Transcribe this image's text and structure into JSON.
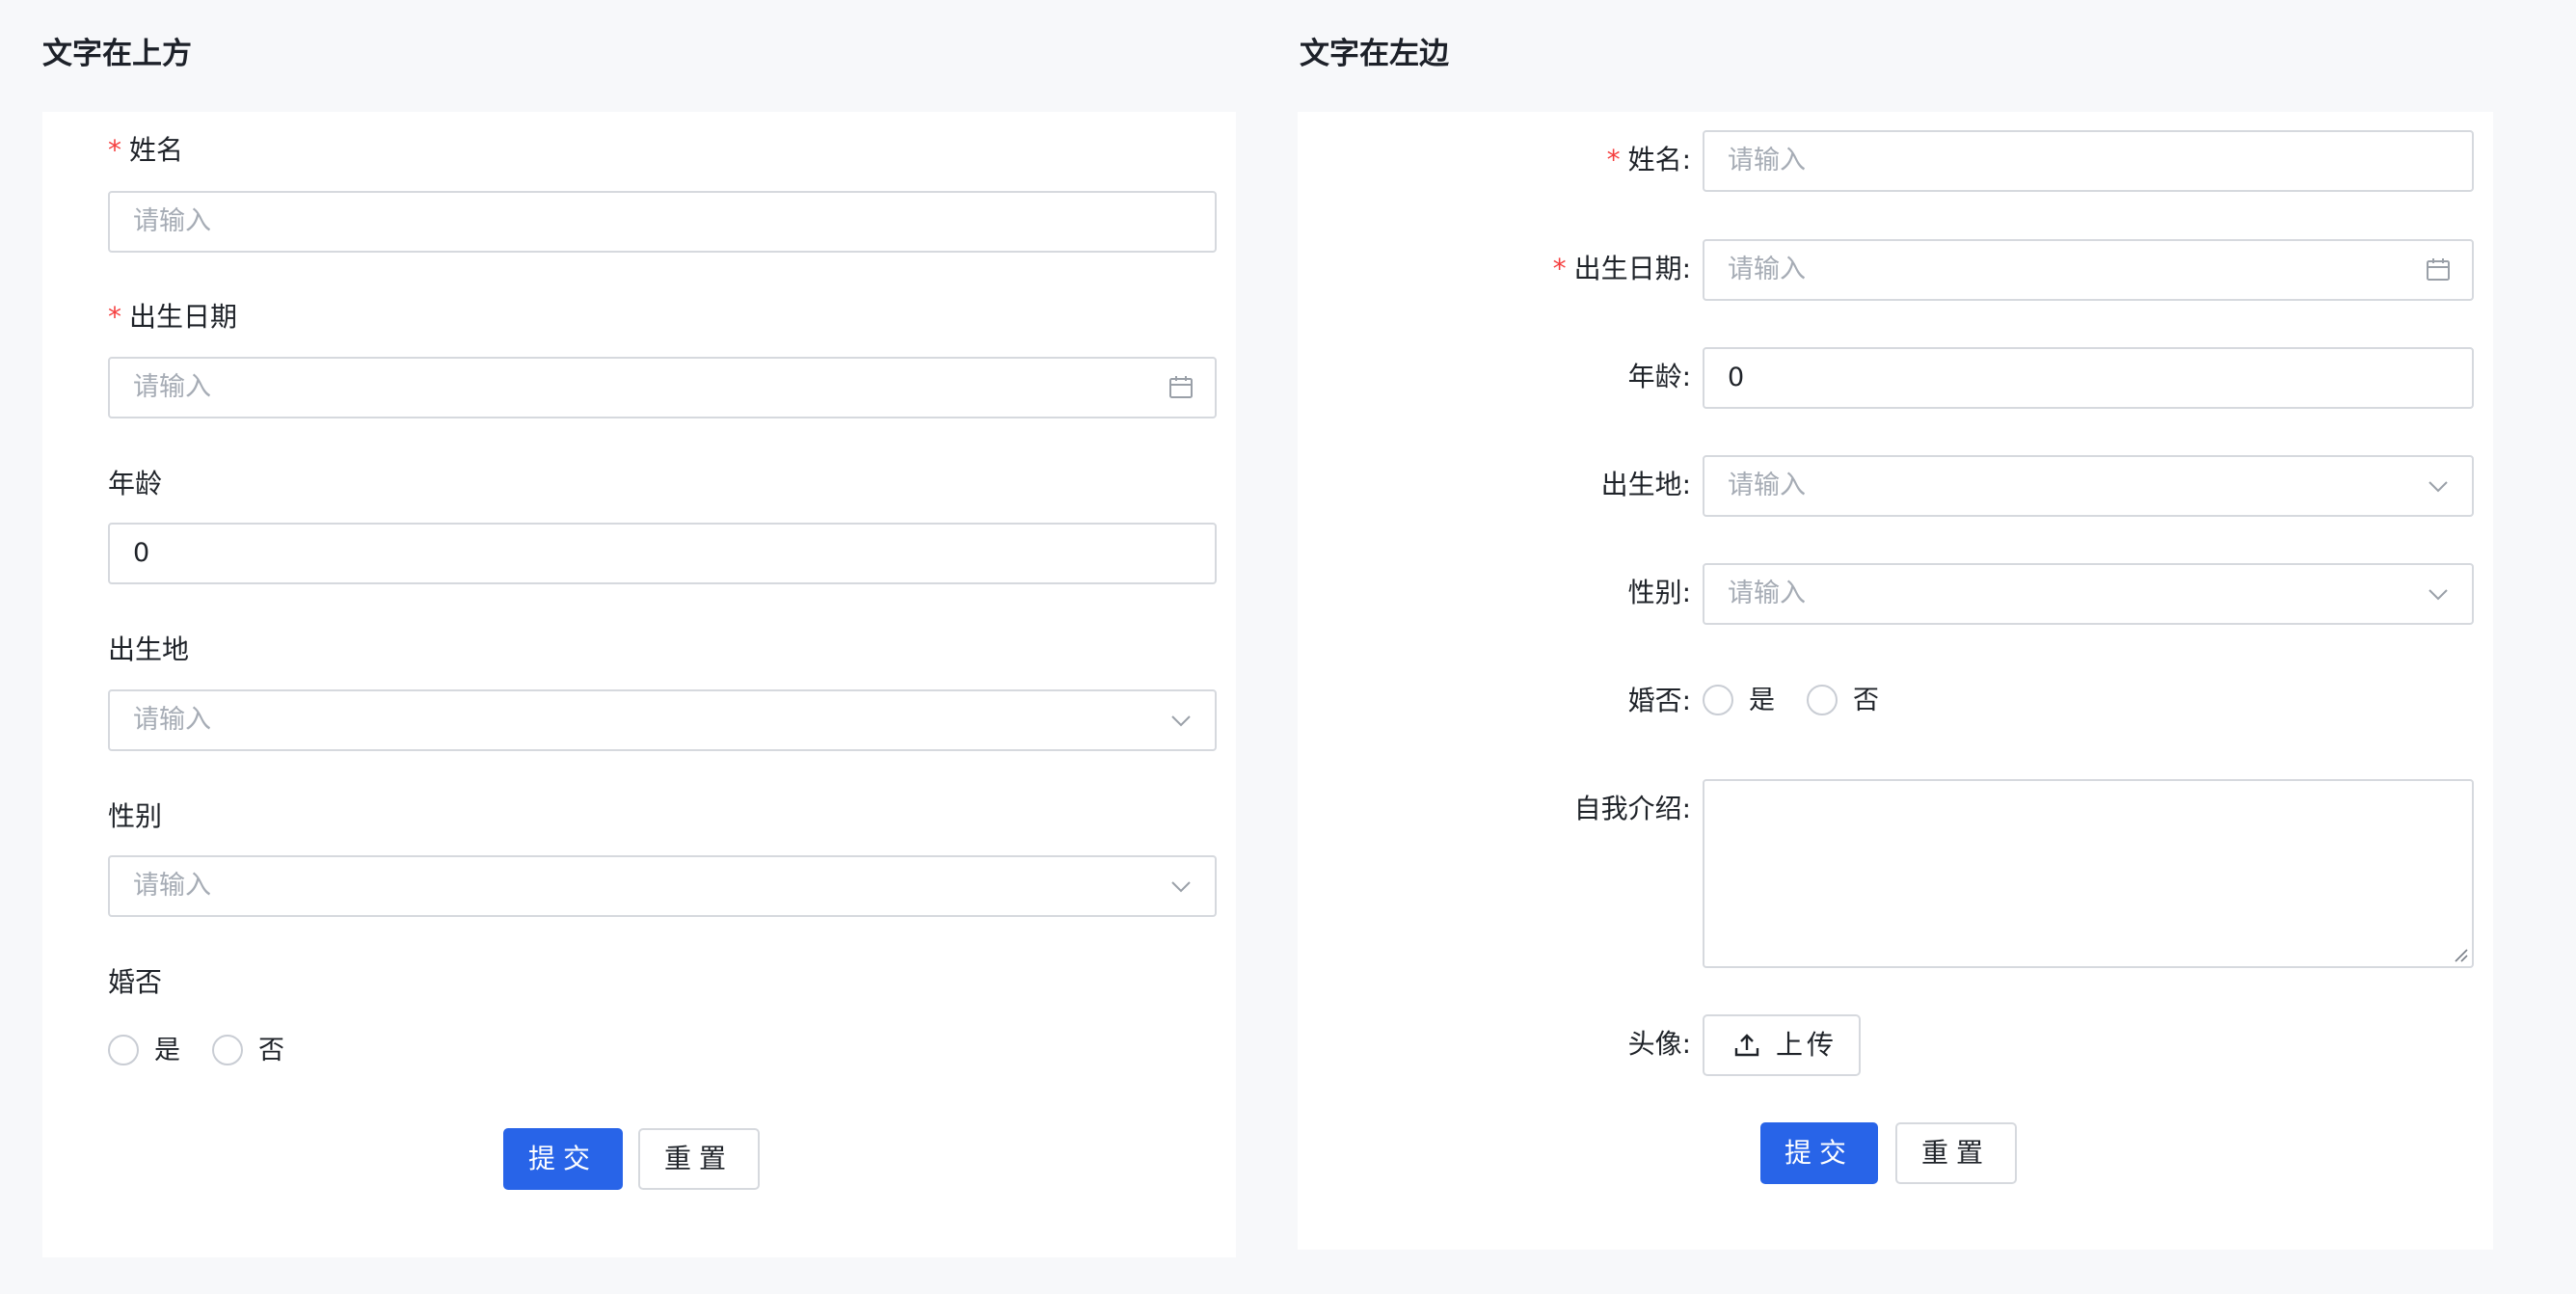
{
  "top_form": {
    "title": "文字在上方",
    "fields": {
      "name": {
        "label": "姓名",
        "placeholder": "请输入",
        "required": "*"
      },
      "birthdate": {
        "label": "出生日期",
        "placeholder": "请输入",
        "required": "*"
      },
      "age": {
        "label": "年龄",
        "value": "0"
      },
      "birthplace": {
        "label": "出生地",
        "placeholder": "请输入"
      },
      "gender": {
        "label": "性别",
        "placeholder": "请输入"
      },
      "married": {
        "label": "婚否",
        "options": [
          "是",
          "否"
        ]
      }
    },
    "buttons": {
      "submit": "提交",
      "reset": "重置"
    }
  },
  "left_form": {
    "title": "文字在左边",
    "fields": {
      "name": {
        "label": "姓名:",
        "placeholder": "请输入",
        "required": "*"
      },
      "birthdate": {
        "label": "出生日期:",
        "placeholder": "请输入",
        "required": "*"
      },
      "age": {
        "label": "年龄:",
        "value": "0"
      },
      "birthplace": {
        "label": "出生地:",
        "placeholder": "请输入"
      },
      "gender": {
        "label": "性别:",
        "placeholder": "请输入"
      },
      "married": {
        "label": "婚否:",
        "options": [
          "是",
          "否"
        ]
      },
      "intro": {
        "label": "自我介绍:"
      },
      "avatar": {
        "label": "头像:",
        "upload_label": "上传"
      }
    },
    "buttons": {
      "submit": "提交",
      "reset": "重置"
    }
  },
  "icons": {
    "calendar": "calendar-icon",
    "dropdown": "chevron-down-icon",
    "upload": "upload-icon",
    "resize": "resize-handle-icon"
  },
  "colors": {
    "primary": "#2864e8",
    "required": "#f53f3f",
    "border": "#d6d9de",
    "placeholder": "#a6acb5",
    "background": "#f7f8fa"
  }
}
